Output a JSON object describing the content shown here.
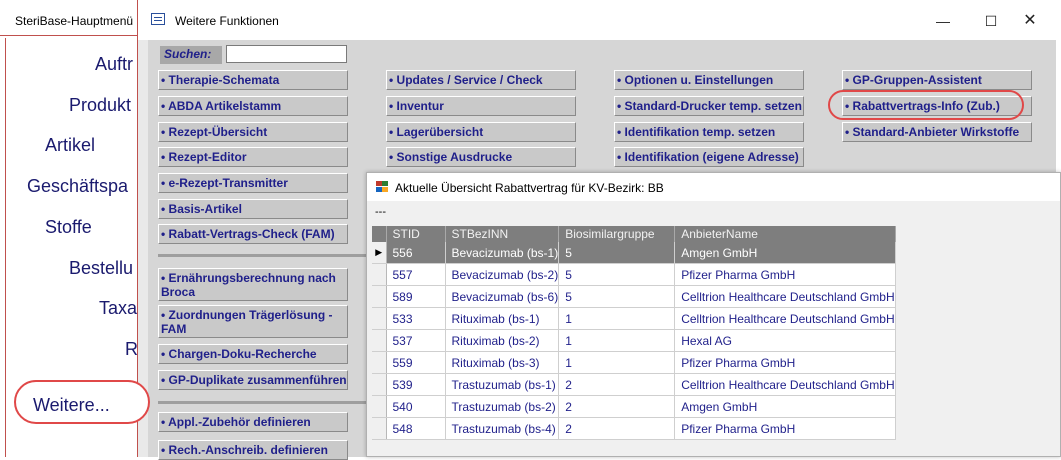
{
  "main_menu": {
    "title": "SteriBase-Hauptmenü",
    "items": [
      "Auftr",
      "Produkt",
      "Artikel",
      "Geschäftspa",
      "Stoffe",
      "Bestellu",
      "Taxa",
      "R"
    ],
    "weitere_label": "Weitere..."
  },
  "window": {
    "title": "Weitere Funktionen",
    "search_label": "Suchen:",
    "search_value": "",
    "columns": [
      [
        "• Therapie-Schemata",
        "• ABDA Artikelstamm",
        "• Rezept-Übersicht",
        "• Rezept-Editor",
        "• e-Rezept-Transmitter",
        "• Basis-Artikel",
        "• Rabatt-Vertrags-Check (FAM)"
      ],
      [
        "• Updates / Service / Check",
        "• Inventur",
        "• Lagerübersicht",
        "• Sonstige Ausdrucke"
      ],
      [
        "• Optionen u. Einstellungen",
        "• Standard-Drucker temp. setzen",
        "• Identifikation temp. setzen",
        "• Identifikation (eigene Adresse)"
      ],
      [
        "• GP-Gruppen-Assistent",
        "• Rabattvertrags-Info (Zub.)",
        "• Standard-Anbieter Wirkstoffe"
      ]
    ],
    "lower_buttons": [
      "• Ernährungsberechnung nach Broca",
      "• Zuordnungen Trägerlösung - FAM",
      "• Chargen-Doku-Recherche",
      "• GP-Duplikate zusammenführen",
      "• Appl.-Zubehör definieren",
      "• Rech.-Anschreib. definieren"
    ]
  },
  "dialog": {
    "title": "Aktuelle Übersicht Rabattvertrag für KV-Bezirk: BB",
    "subtitle": "---",
    "headers": [
      "STID",
      "STBezINN",
      "Biosimilargruppe",
      "AnbieterName"
    ],
    "rows": [
      [
        "556",
        "Bevacizumab (bs-1)",
        "5",
        "Amgen GmbH"
      ],
      [
        "557",
        "Bevacizumab (bs-2)",
        "5",
        "Pfizer Pharma GmbH"
      ],
      [
        "589",
        "Bevacizumab (bs-6)",
        "5",
        "Celltrion Healthcare Deutschland GmbH"
      ],
      [
        "533",
        "Rituximab (bs-1)",
        "1",
        "Celltrion Healthcare Deutschland GmbH"
      ],
      [
        "537",
        "Rituximab (bs-2)",
        "1",
        "Hexal AG"
      ],
      [
        "559",
        "Rituximab (bs-3)",
        "1",
        "Pfizer Pharma GmbH"
      ],
      [
        "539",
        "Trastuzumab (bs-1)",
        "2",
        "Celltrion Healthcare Deutschland GmbH"
      ],
      [
        "540",
        "Trastuzumab (bs-2)",
        "2",
        "Amgen GmbH"
      ],
      [
        "548",
        "Trastuzumab (bs-4)",
        "2",
        "Pfizer Pharma GmbH"
      ]
    ],
    "current_row": 0
  },
  "colors": {
    "accent_red": "#e04848",
    "button_text": "#1f1f8a",
    "grid_header": "#7e7e7e"
  }
}
